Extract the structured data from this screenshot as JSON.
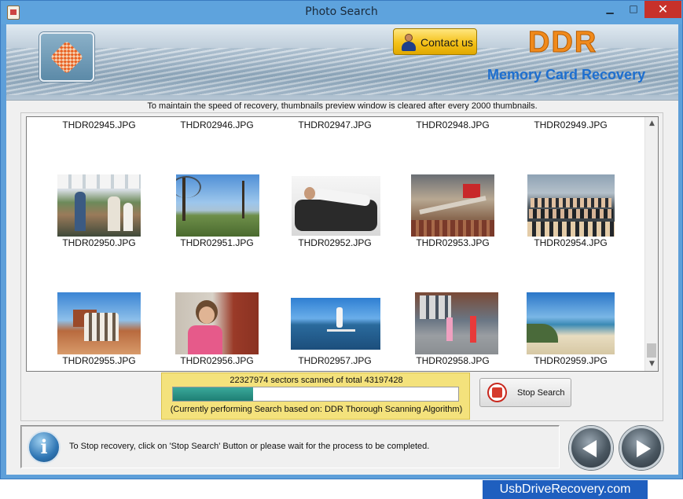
{
  "window": {
    "title": "Photo Search",
    "minimize_glyph": "▁",
    "maximize_glyph": "□",
    "close_glyph": "✕"
  },
  "header": {
    "contact_label": "Contact us",
    "brand": "DDR",
    "product": "Memory Card Recovery"
  },
  "notice": "To maintain the speed of recovery, thumbnails preview window is cleared after every 2000 thumbnails.",
  "thumbnails": {
    "row1_labels": [
      "THDR02945.JPG",
      "THDR02946.JPG",
      "THDR02947.JPG",
      "THDR02948.JPG",
      "THDR02949.JPG"
    ],
    "row2_labels": [
      "THDR02950.JPG",
      "THDR02951.JPG",
      "THDR02952.JPG",
      "THDR02953.JPG",
      "THDR02954.JPG"
    ],
    "row3_labels": [
      "THDR02955.JPG",
      "THDR02956.JPG",
      "THDR02957.JPG",
      "THDR02958.JPG",
      "THDR02959.JPG"
    ],
    "row2_subjects": [
      "market-crowd",
      "lake-tree",
      "woman-on-sofa",
      "building-atrium",
      "group-photo"
    ],
    "row3_subjects": [
      "desert-group",
      "girl-brick-wall",
      "paddleboard-sea",
      "kids-playing",
      "beach-shore"
    ]
  },
  "scan": {
    "sectors_text": "22327974 sectors scanned of total 43197428",
    "progress_fraction": 0.28,
    "algorithm_text": "(Currently performing Search based on:  DDR Thorough Scanning Algorithm)"
  },
  "stop_button_label": "Stop Search",
  "status_text": "To Stop recovery, click on 'Stop Search' Button or please wait for the process to be completed.",
  "footer": "UsbDriveRecovery.com",
  "colors": {
    "titlebar": "#5ea3dd",
    "close": "#c7312a",
    "brand_orange": "#f08a1c",
    "product_blue": "#1e6fcf",
    "progress_panel": "#f4e27c",
    "progress_fill": "#1e7f74",
    "footer": "#1f5fbf"
  }
}
